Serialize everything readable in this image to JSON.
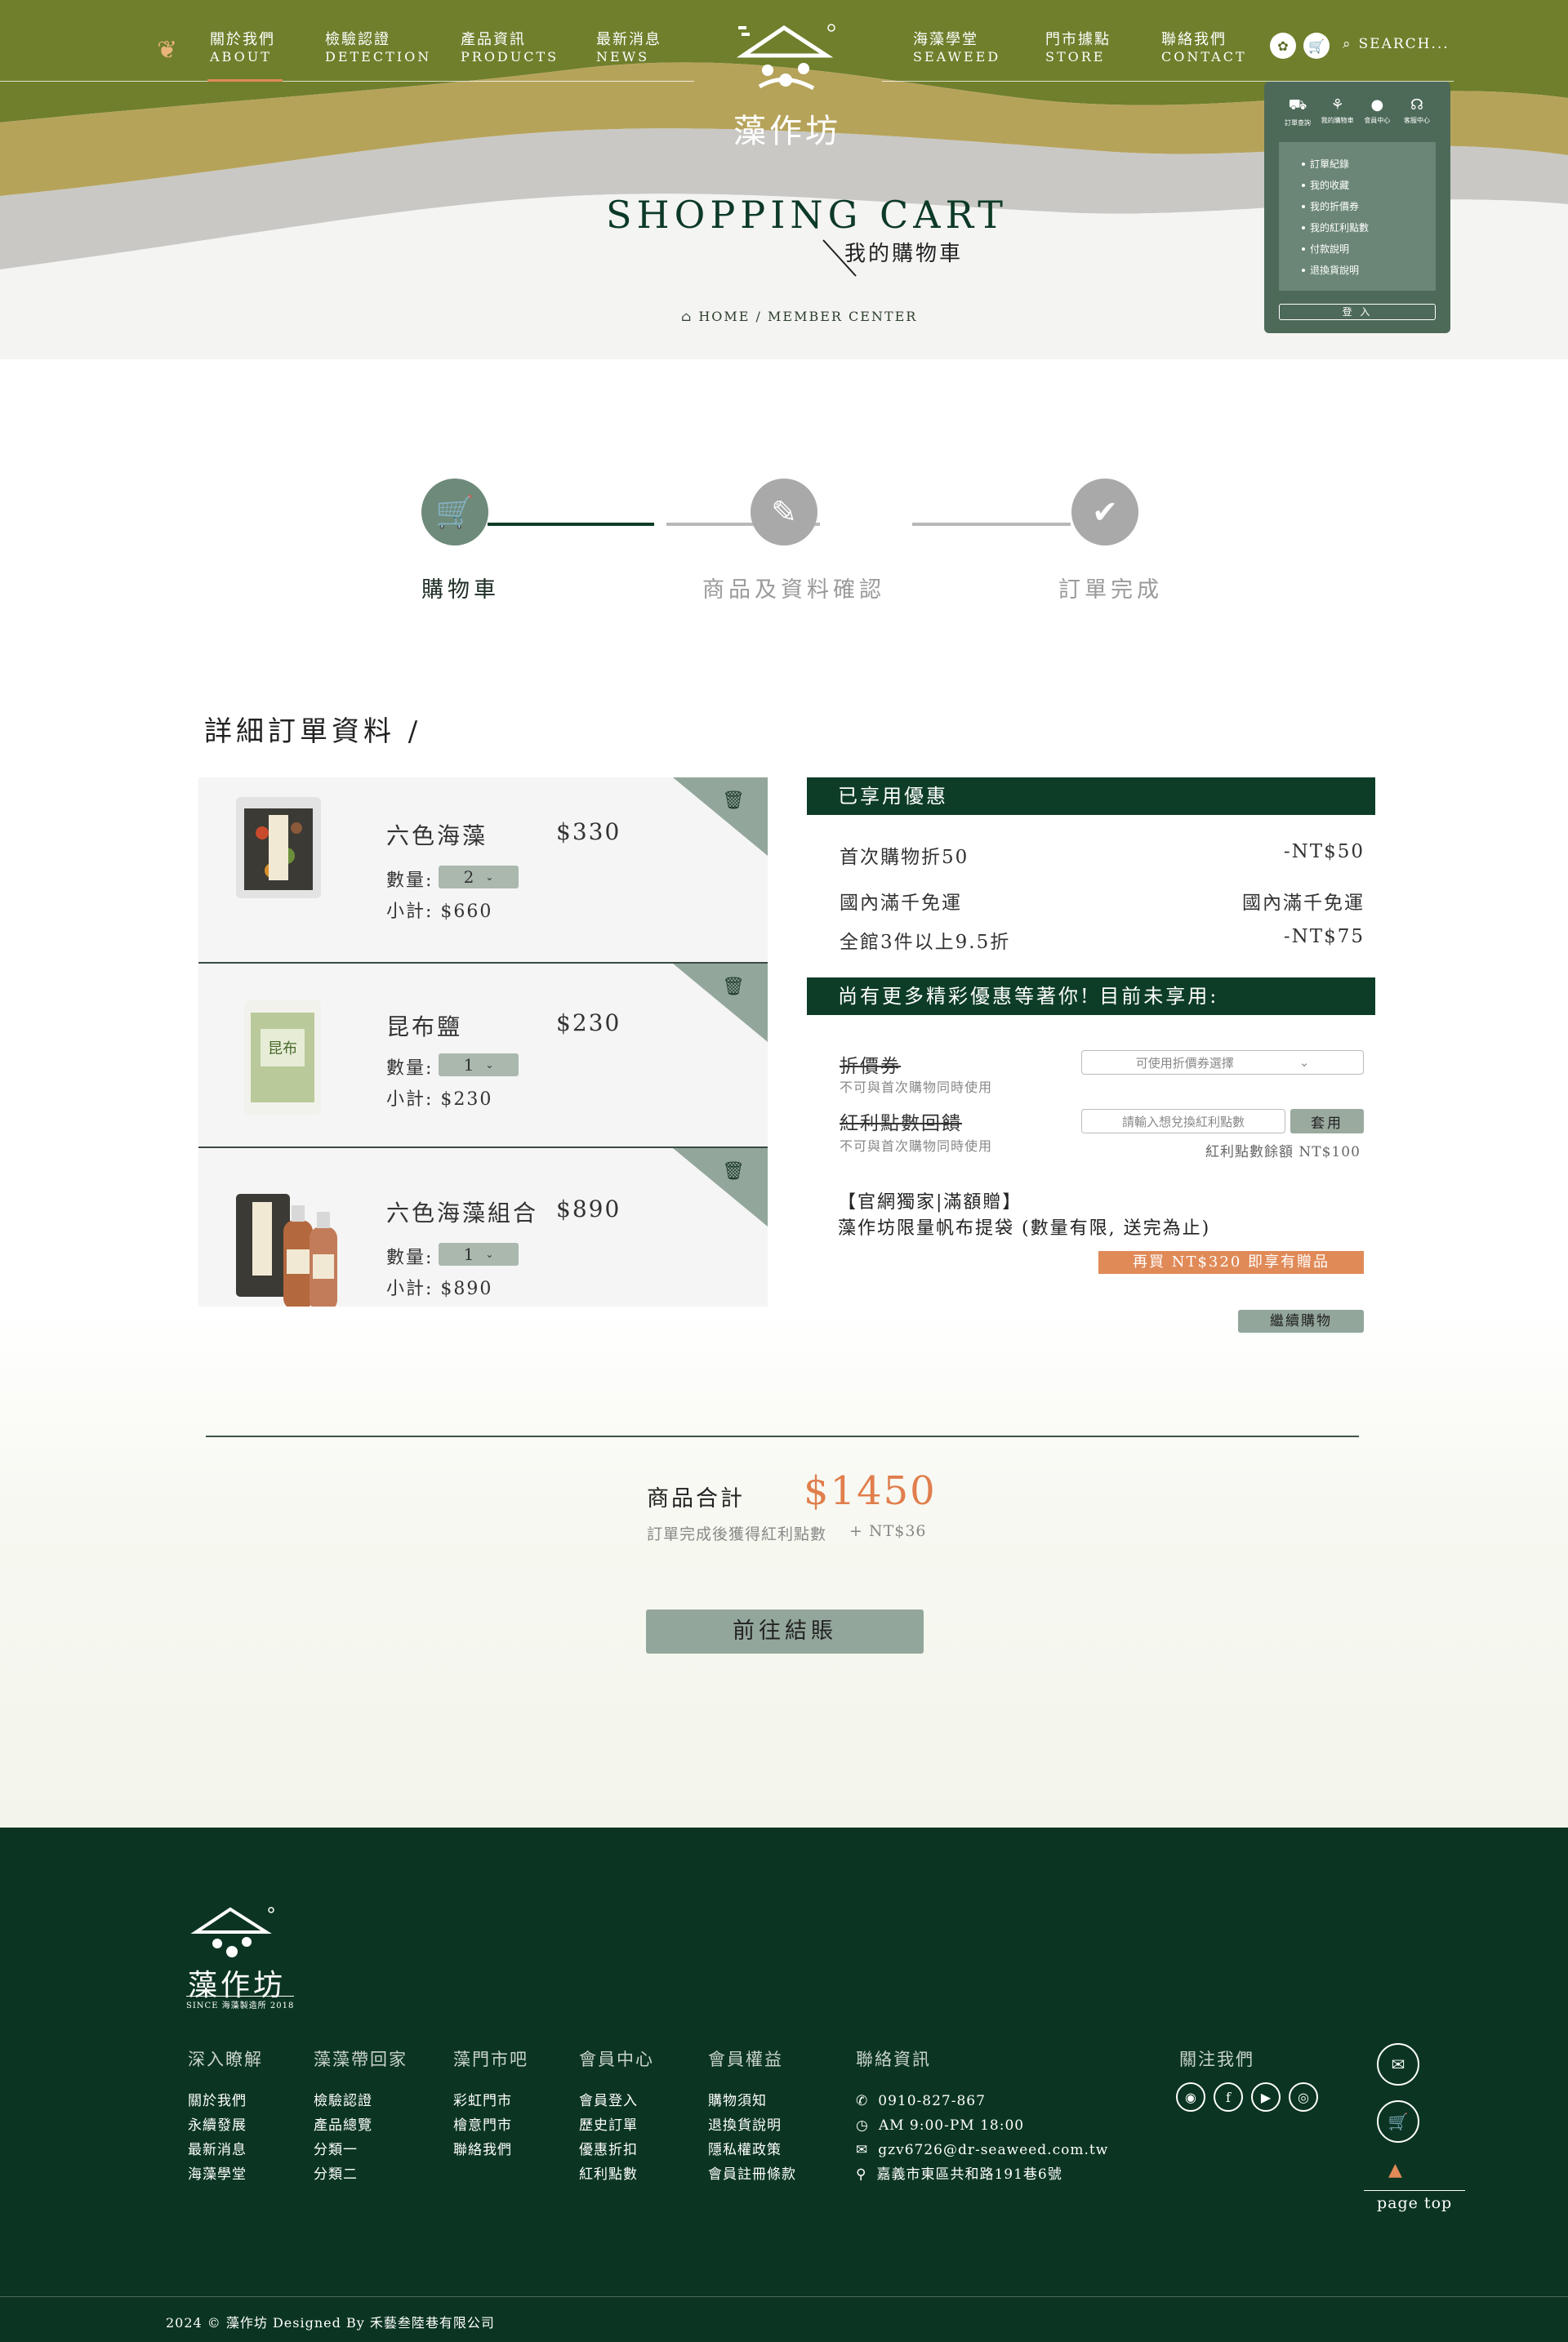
{
  "header": {
    "nav_left": [
      {
        "zh": "關於我們",
        "en": "ABOUT"
      },
      {
        "zh": "檢驗認證",
        "en": "DETECTION"
      },
      {
        "zh": "產品資訊",
        "en": "PRODUCTS"
      },
      {
        "zh": "最新消息",
        "en": "NEWS"
      }
    ],
    "nav_right": [
      {
        "zh": "海藻學堂",
        "en": "SEAWEED"
      },
      {
        "zh": "門市據點",
        "en": "STORE"
      },
      {
        "zh": "聯絡我們",
        "en": "CONTACT"
      }
    ],
    "logo_text": "藻作坊",
    "search_placeholder": "SEARCH...",
    "page_title_en": "SHOPPING CART",
    "page_title_zh": "我的購物車",
    "breadcrumb": "HOME / MEMBER CENTER"
  },
  "member_menu": {
    "icons": [
      "訂單查詢",
      "我的購物車",
      "會員中心",
      "客服中心"
    ],
    "links": [
      "訂單紀錄",
      "我的收藏",
      "我的折價券",
      "我的紅利點數",
      "付款說明",
      "退換貨說明"
    ],
    "login": "登 入"
  },
  "steps": [
    {
      "label": "購物車",
      "active": true
    },
    {
      "label": "商品及資料確認",
      "active": false
    },
    {
      "label": "訂單完成",
      "active": false
    }
  ],
  "section_title": "詳細訂單資料 /",
  "cart_items": [
    {
      "name": "六色海藻",
      "price": "$330",
      "qty_label": "數量:",
      "qty": "2",
      "subtotal": "小計: $660"
    },
    {
      "name": "昆布鹽",
      "price": "$230",
      "qty_label": "數量:",
      "qty": "1",
      "subtotal": "小計: $230"
    },
    {
      "name": "六色海藻組合",
      "price": "$890",
      "qty_label": "數量:",
      "qty": "1",
      "subtotal": "小計: $890"
    }
  ],
  "applied": {
    "title": "已享用優惠",
    "rows": [
      {
        "label": "首次購物折50",
        "value": "-NT$50"
      },
      {
        "label": "國內滿千免運",
        "value": "國內滿千免運"
      },
      {
        "label": "全館3件以上9.5折",
        "value": "-NT$75"
      }
    ]
  },
  "more_offers": {
    "title": "尚有更多精彩優惠等著你! 目前未享用:",
    "coupon_label": "折價券",
    "coupon_note": "不可與首次購物同時使用",
    "coupon_select": "可使用折價券選擇",
    "bonus_label": "紅利點數回饋",
    "bonus_note": "不可與首次購物同時使用",
    "bonus_placeholder": "請輸入想兌換紅利點數",
    "apply": "套用",
    "bonus_rest": "紅利點數餘額 NT$100",
    "promo_line1": "【官網獨家|滿額贈】",
    "promo_line2": "藻作坊限量帆布提袋 (數量有限, 送完為止)",
    "promo_button": "再買 NT$320 即享有贈品",
    "continue": "繼續購物"
  },
  "summary": {
    "label": "商品合計",
    "total": "$1450",
    "note": "訂單完成後獲得紅利點數",
    "points": "+ NT$36",
    "checkout": "前往結賬"
  },
  "footer": {
    "logo_text": "藻作坊",
    "since": "SINCE 海藻製造所 2018",
    "columns": [
      {
        "title": "深入瞭解",
        "items": [
          "關於我們",
          "永續發展",
          "最新消息",
          "海藻學堂"
        ]
      },
      {
        "title": "藻藻帶回家",
        "items": [
          "檢驗認證",
          "產品總覽",
          "分類一",
          "分類二"
        ]
      },
      {
        "title": "藻門市吧",
        "items": [
          "彩虹門市",
          "檜意門市",
          "聯絡我們"
        ]
      },
      {
        "title": "會員中心",
        "items": [
          "會員登入",
          "歷史訂單",
          "優惠折扣",
          "紅利點數"
        ]
      },
      {
        "title": "會員權益",
        "items": [
          "購物須知",
          "退換貨說明",
          "隱私權政策",
          "會員註冊條款"
        ]
      }
    ],
    "contact_title": "聯絡資訊",
    "contact": [
      "0910-827-867",
      "AM 9:00-PM 18:00",
      "gzv6726@dr-seaweed.com.tw",
      "嘉義市東區共和路191巷6號"
    ],
    "follow_title": "關注我們",
    "page_top": "page top",
    "copyright": "2024 © 藻作坊 Designed By 禾藝叁陸巷有限公司"
  },
  "colors": {
    "dark_green": "#0b3522",
    "olive": "#7c8f2e",
    "sage": "#93a69b",
    "accent": "#e08a58"
  }
}
